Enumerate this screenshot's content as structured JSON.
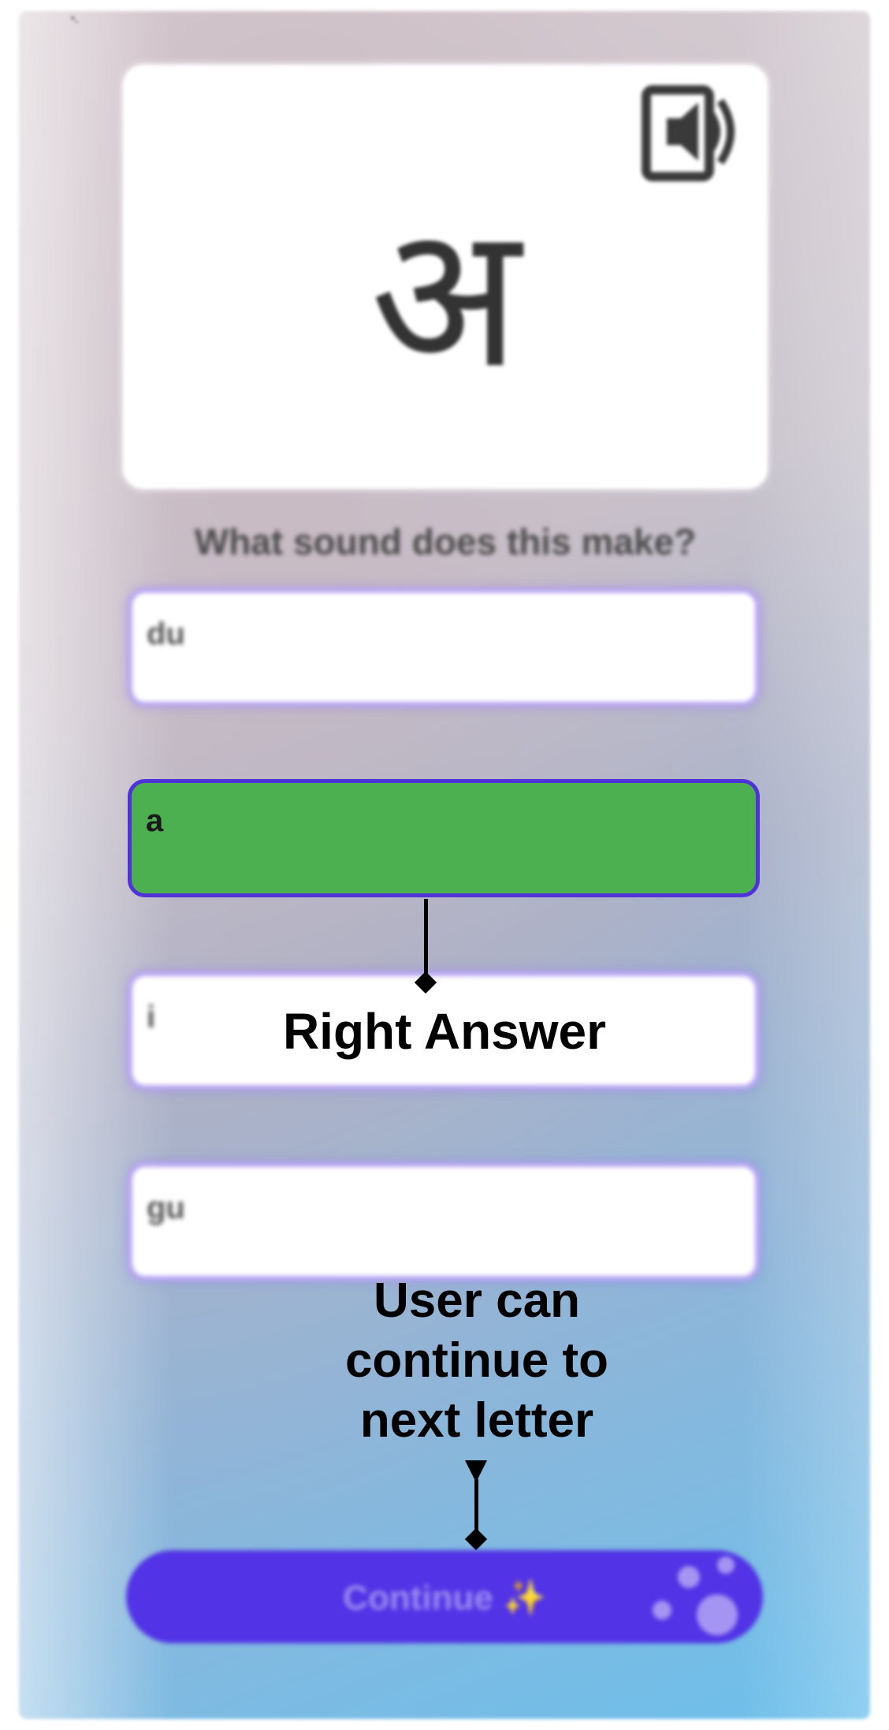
{
  "back_button": {
    "icon": "back-arrow-icon"
  },
  "letter_card": {
    "letter": "अ",
    "audio_icon": "speaker-card-icon"
  },
  "prompt": "What sound does this make?",
  "options": [
    {
      "label": "du",
      "state": "default"
    },
    {
      "label": "a",
      "state": "correct"
    },
    {
      "label": "i",
      "state": "default"
    },
    {
      "label": "gu",
      "state": "default"
    }
  ],
  "annotations": {
    "right_answer": "Right Answer",
    "continue_note_line1": "User can",
    "continue_note_line2": "continue to",
    "continue_note_line3": "next letter"
  },
  "continue_button": {
    "label": "Continue ✨",
    "icon": "sparkle-icon"
  },
  "colors": {
    "correct_fill": "#4caf50",
    "correct_border": "#5033d8",
    "option_border": "#b9a7f2",
    "button_fill": "#5233e6",
    "annotation": "#000000"
  }
}
